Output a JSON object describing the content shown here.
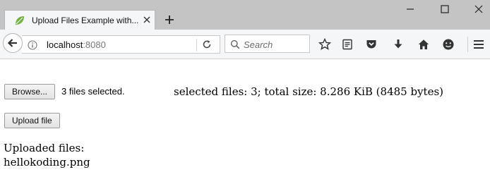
{
  "browser": {
    "tab": {
      "title": "Upload Files Example with..."
    },
    "address": {
      "host": "localhost",
      "port": ":8080"
    },
    "search": {
      "placeholder": "Search"
    },
    "colors": {
      "tabbar": "#c4c4c4",
      "toolbar": "#f5f6f7",
      "spring_leaf": "#6db33f"
    }
  },
  "page": {
    "browse_label": "Browse...",
    "files_selected": "3 files selected.",
    "selection_summary": "selected files: 3; total size: 8.286 KiB (8485 bytes)",
    "upload_label": "Upload file",
    "uploaded_heading": "Uploaded files:",
    "uploaded_files": [
      "hellokoding.png"
    ]
  }
}
